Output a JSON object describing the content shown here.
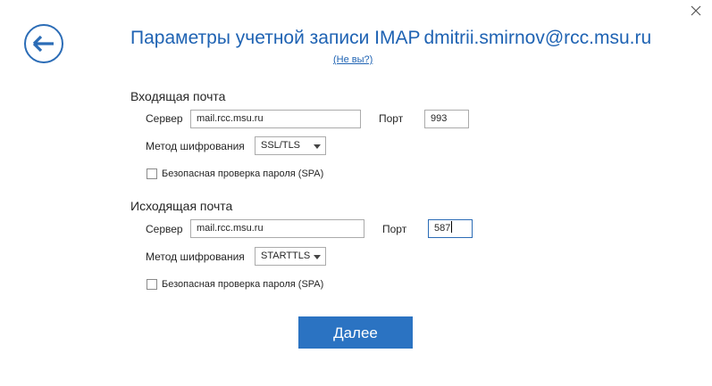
{
  "header": {
    "title": "Параметры учетной записи IMAP",
    "email": "dmitrii.smirnov@rcc.msu.ru",
    "not_you": "(Не вы?)"
  },
  "incoming": {
    "heading": "Входящая почта",
    "server_label": "Сервер",
    "server_value": "mail.rcc.msu.ru",
    "port_label": "Порт",
    "port_value": "993",
    "encryption_label": "Метод шифрования",
    "encryption_value": "SSL/TLS",
    "spa_label": "Безопасная проверка пароля (SPA)",
    "spa_checked": false
  },
  "outgoing": {
    "heading": "Исходящая почта",
    "server_label": "Сервер",
    "server_value": "mail.rcc.msu.ru",
    "port_label": "Порт",
    "port_value": "587",
    "encryption_label": "Метод шифрования",
    "encryption_value": "STARTTLS",
    "spa_label": "Безопасная проверка пароля (SPA)",
    "spa_checked": false
  },
  "actions": {
    "next_label": "Далее"
  },
  "icons": {
    "close": "close-icon",
    "back": "back-arrow-icon",
    "dropdown": "chevron-down-icon"
  },
  "colors": {
    "accent": "#2b6cb6",
    "button": "#2b73c2",
    "text": "#262626"
  }
}
